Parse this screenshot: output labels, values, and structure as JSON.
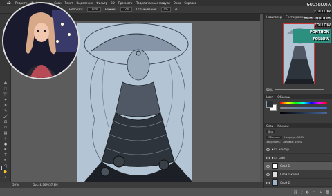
{
  "menu": {
    "app_badge": "42",
    "items": [
      "Редакти",
      "Изображение",
      "Слои",
      "Текст",
      "Выделение",
      "Фильтр",
      "3D",
      "Просмотр",
      "Подключаемые модули",
      "Окно",
      "Справка"
    ]
  },
  "options": {
    "opacity_label": "Непрозр.:",
    "opacity_value": "100%",
    "flow_label": "Нажим:",
    "flow_value": "12%",
    "smoothing_label": "Сглаживание:",
    "smoothing_value": "0%"
  },
  "document_tab": {
    "label": "Untitled-1 @ 50% (Слой 1, RGB/8)"
  },
  "status": {
    "zoom": "50%",
    "doc_info": "Док: 8,36M/37,8M"
  },
  "panels": {
    "navigator_tabs": [
      "Навигатор",
      "Гистограмма"
    ],
    "zoom_value": "50%",
    "color_tabs": [
      "Цвет",
      "Образцы"
    ],
    "layers_tabs": [
      "Слои",
      "Каналы"
    ],
    "kind_filter": "Вид",
    "blend_mode": "Обычные",
    "opacity_label": "Непрозр.: 100%",
    "fill_label": "Заливка: 100%",
    "lock_label": "Закрепить:",
    "layers": [
      {
        "name": "контур"
      },
      {
        "name": "свет"
      },
      {
        "name": "Слой 1"
      },
      {
        "name": "Слой 1 копия"
      },
      {
        "name": "Слой 2"
      }
    ]
  },
  "stream_overlay": {
    "line1": "GOOSEKOTA FOLLOW",
    "line2": "MIMOHODOM FOLLOW",
    "line3": "PONTHON FOLLOW"
  },
  "colors": {
    "canvas": "#b3c4d4",
    "accent_red": "#c83a3a",
    "overlay_highlight": "#2d8f7f"
  }
}
